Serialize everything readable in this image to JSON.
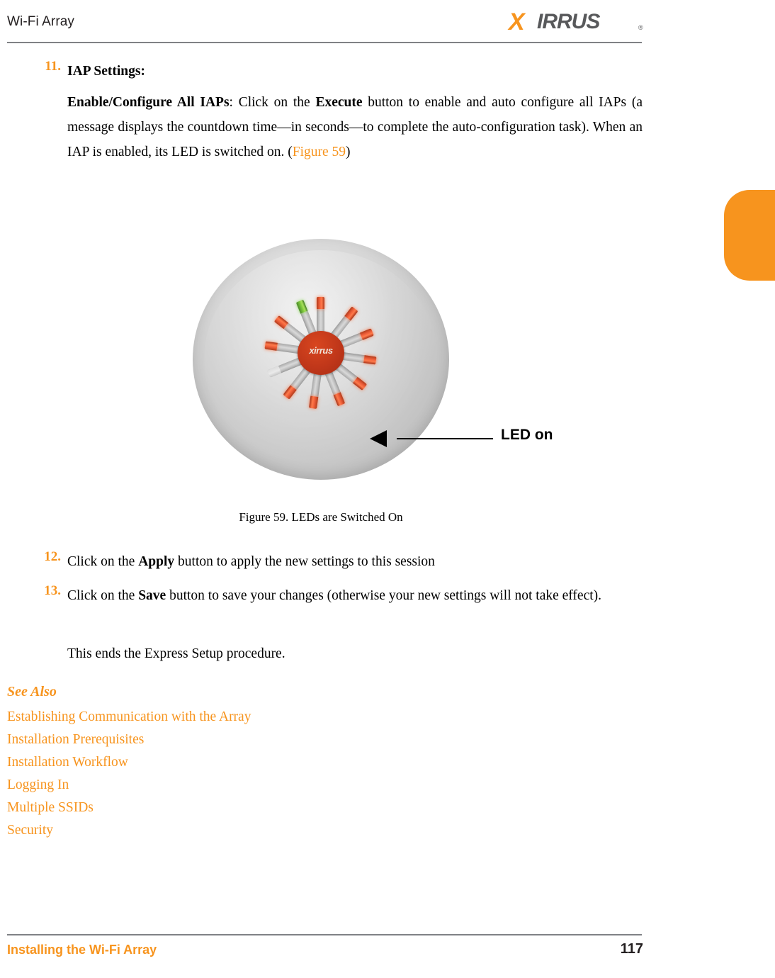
{
  "header": {
    "title": "Wi-Fi Array",
    "logo_text": "IRRUS",
    "logo_x": "X",
    "logo_registered": "®"
  },
  "steps": [
    {
      "number": "11.",
      "title": "IAP Settings:",
      "body_html": "<b>Enable/Configure All IAPs</b>: Click on the <b>Execute</b> button to enable and auto configure all IAPs (a message displays the countdown time—in seconds—to complete the auto-configuration task). When an IAP is enabled, its LED is switched on. (<span class=\"link\">Figure 59</span>)"
    },
    {
      "number": "12.",
      "body_html": "Click on the <b>Apply</b> button to apply the new settings to this session"
    },
    {
      "number": "13.",
      "body_html": "Click on the <b>Save</b> button to save your changes (otherwise your new settings will not take effect)."
    }
  ],
  "closing_text": "This ends the Express Setup procedure.",
  "figure": {
    "callout_label": "LED on",
    "caption": "Figure 59. LEDs are Switched On",
    "device_logo": "xirrus"
  },
  "see_also": {
    "title": "See Also",
    "links": [
      "Establishing Communication with the Array",
      "Installation Prerequisites",
      "Installation Workflow",
      "Logging In",
      "Multiple SSIDs",
      "Security"
    ]
  },
  "footer": {
    "left": "Installing the Wi-Fi Array",
    "page_number": "117"
  },
  "colors": {
    "accent": "#f7941e",
    "rule": "#808285",
    "text": "#000000"
  }
}
